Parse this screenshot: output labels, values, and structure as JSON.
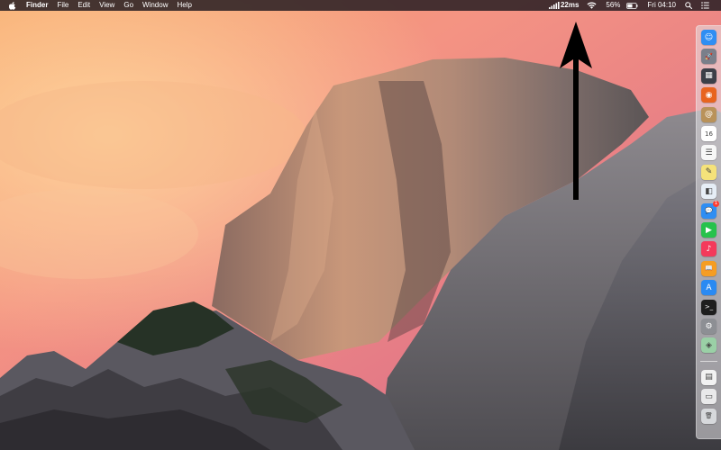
{
  "menubar": {
    "app_name": "Finder",
    "menus": [
      "File",
      "Edit",
      "View",
      "Go",
      "Window",
      "Help"
    ],
    "status": {
      "ping": "22ms",
      "battery_percent": "56%",
      "clock": "Fri 04:10"
    }
  },
  "dock": {
    "apps": [
      {
        "name": "finder",
        "glyph": "☺",
        "color": "#2f8ef3"
      },
      {
        "name": "launchpad",
        "glyph": "🚀",
        "color": "#7a7f8a"
      },
      {
        "name": "mission-control",
        "glyph": "▦",
        "color": "#3b3f48"
      },
      {
        "name": "firefox",
        "glyph": "◉",
        "color": "#e8641f"
      },
      {
        "name": "contacts",
        "glyph": "@",
        "color": "#b9925a"
      },
      {
        "name": "calendar",
        "glyph": "16",
        "color": "#ffffff"
      },
      {
        "name": "reminders",
        "glyph": "☰",
        "color": "#f7f7f7"
      },
      {
        "name": "notes",
        "glyph": "✎",
        "color": "#f5e27a"
      },
      {
        "name": "preview",
        "glyph": "◧",
        "color": "#e6eef6"
      },
      {
        "name": "messages",
        "glyph": "💬",
        "color": "#2f8ef3",
        "badge": "1"
      },
      {
        "name": "facetime",
        "glyph": "▶",
        "color": "#27c24c"
      },
      {
        "name": "itunes",
        "glyph": "♪",
        "color": "#f43a5b"
      },
      {
        "name": "ibooks",
        "glyph": "📖",
        "color": "#f59d23"
      },
      {
        "name": "app-store",
        "glyph": "A",
        "color": "#2a8af2"
      },
      {
        "name": "terminal",
        "glyph": ">_",
        "color": "#1e1e1e"
      },
      {
        "name": "system-preferences",
        "glyph": "⚙",
        "color": "#8d8f94"
      },
      {
        "name": "security",
        "glyph": "◈",
        "color": "#9ad0a6"
      },
      {
        "name": "document",
        "glyph": "▤",
        "color": "#f2f2f2"
      },
      {
        "name": "downloads",
        "glyph": "▭",
        "color": "#e9e9ea"
      },
      {
        "name": "trash",
        "glyph": "🗑",
        "color": "#d7d9dc"
      }
    ]
  },
  "colors": {
    "menubar_bg": "#2a1f24",
    "arrow": "#000000"
  }
}
